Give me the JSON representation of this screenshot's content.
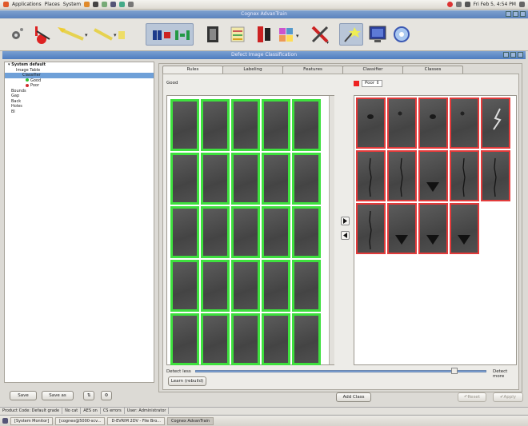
{
  "panel": {
    "menu": [
      "Applications",
      "Places",
      "System"
    ],
    "clock": "Fri Feb  5, 4:54 PM"
  },
  "window": {
    "title": "Cognex AdvanTrain"
  },
  "inner": {
    "title": "Defect Image Classification"
  },
  "tree": {
    "root": "System default",
    "items": [
      {
        "label": "Image Table",
        "indent": 14
      },
      {
        "label": "Classifier",
        "indent": 22,
        "selected": true
      },
      {
        "label": "Good",
        "indent": 26,
        "dot": "#2fbf2f"
      },
      {
        "label": "Poor",
        "indent": 26,
        "dot": "#d03030"
      },
      {
        "label": "Bounds",
        "indent": 8
      },
      {
        "label": "Gap",
        "indent": 8
      },
      {
        "label": "Back",
        "indent": 8
      },
      {
        "label": "Holes",
        "indent": 8
      },
      {
        "label": "Bl",
        "indent": 8
      }
    ]
  },
  "tabs": [
    "Rules",
    "Labeling",
    "Features",
    "Classifier",
    "Classes"
  ],
  "good_label": "Good",
  "poor_select": "Poor",
  "slider": {
    "left": "Detect less",
    "right": "Detect more",
    "value": 0.89
  },
  "buttons": {
    "learn": "Learn (rebuild)",
    "add_class": "Add Class",
    "save": "Save",
    "save_as": "Save as",
    "reset": "Reset",
    "apply": "Apply"
  },
  "statusbar": [
    "Product Code: Default grade",
    "No cat",
    "AES on",
    "CS errors",
    "User: Administrator"
  ],
  "taskbar": [
    "[System Monitor]",
    "[cognex@5000-scv...",
    "D-EVRIM 2DV - File Bro...",
    "Cognex AdvanTrain"
  ],
  "good_tiles": 25,
  "poor_tiles": [
    {
      "mark": "blob"
    },
    {
      "mark": "spot"
    },
    {
      "mark": "blob"
    },
    {
      "mark": "spot"
    },
    {
      "mark": "spark"
    },
    {
      "mark": "crack"
    },
    {
      "mark": "crack"
    },
    {
      "mark": "tri"
    },
    {
      "mark": "crack"
    },
    {
      "mark": "crack"
    },
    {
      "mark": "crack"
    },
    {
      "mark": "tri"
    },
    {
      "mark": "tri"
    },
    {
      "mark": "tri"
    }
  ]
}
